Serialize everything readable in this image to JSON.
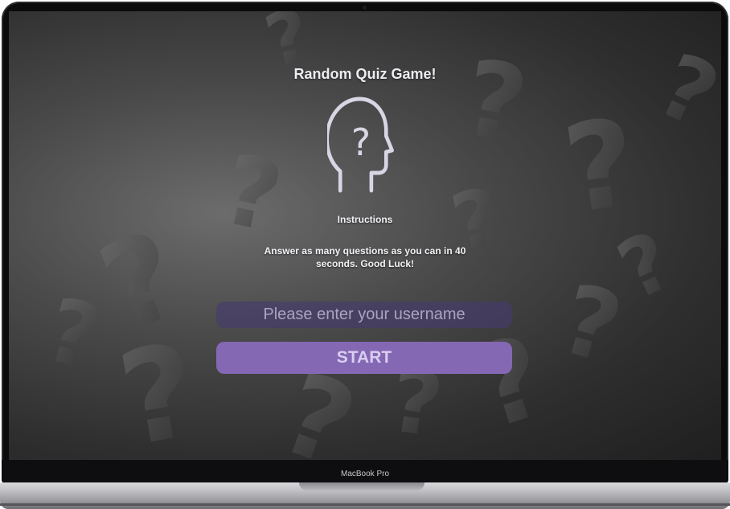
{
  "device": {
    "label": "MacBook Pro"
  },
  "app": {
    "title": "Random Quiz Game!",
    "icon": "head-question-icon",
    "background_art": "question-marks-pattern"
  },
  "instructions": {
    "heading": "Instructions",
    "text": "Answer as many questions as you can in 40 seconds. Good Luck!"
  },
  "username": {
    "placeholder": "Please enter your username",
    "value": ""
  },
  "start_button": {
    "label": "START"
  },
  "colors": {
    "accent": "#8468b4",
    "input_bg": "#463a6e",
    "icon_stroke": "#d8d6e4"
  }
}
